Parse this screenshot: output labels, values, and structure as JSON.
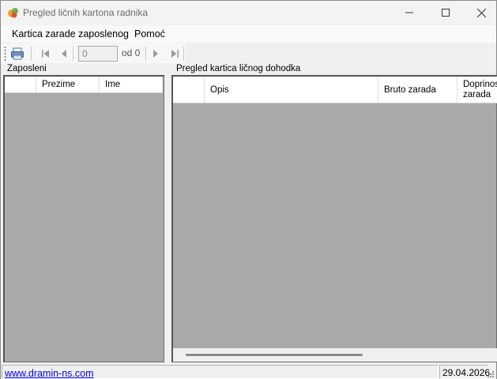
{
  "window": {
    "title": "Pregled ličnih kartona radnika",
    "icon": "app-icon",
    "controls": [
      "minimize-icon",
      "maximize-icon",
      "close-icon"
    ]
  },
  "menu": {
    "items": [
      {
        "label": "Kartica zarade zaposlenog"
      },
      {
        "label": "Pomoć"
      }
    ]
  },
  "toolbar": {
    "icons": [
      "print-icon",
      "move-first-icon",
      "move-previous-icon",
      "move-next-icon",
      "move-last-icon"
    ],
    "position_value": "0",
    "of_label": "od 0"
  },
  "employees": {
    "group_label": "Zaposleni",
    "columns": [
      "",
      "Prezime",
      "Ime"
    ],
    "rows": []
  },
  "income": {
    "group_label": "Pregled kartica ličnog dohodka",
    "columns": [
      "",
      "Opis",
      "Bruto zarada",
      "Doprinos zarada"
    ],
    "rows": []
  },
  "status": {
    "link": "www.dramin-ns.com",
    "date": "29.04.2026"
  },
  "colors": {
    "grid_background": "#a9a9a9",
    "link": "#0000ee",
    "window_background": "#f0f0f0"
  }
}
